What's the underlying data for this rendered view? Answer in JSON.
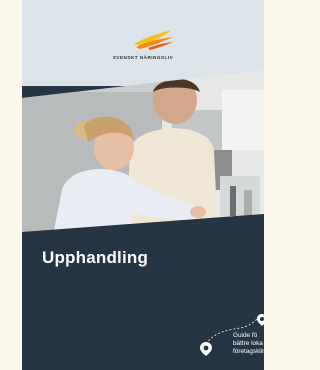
{
  "brand": {
    "name": "SVENSKT NÄRINGSLIV"
  },
  "cover": {
    "title": "Upphandling",
    "guide_lines": [
      "Guide fö",
      "bättre loka",
      "företagsklima"
    ]
  },
  "icons": {
    "logo": "svenskt-naringsliv-logo-icon",
    "pin_small": "location-pin-icon",
    "pin_large": "location-pin-icon",
    "path": "dashed-route-icon"
  },
  "colors": {
    "page_bg": "#fbf7ea",
    "cover_top": "#dde4e9",
    "navy": "#253543",
    "logo_orange": "#f08a1d",
    "logo_yellow": "#f6c21a"
  }
}
